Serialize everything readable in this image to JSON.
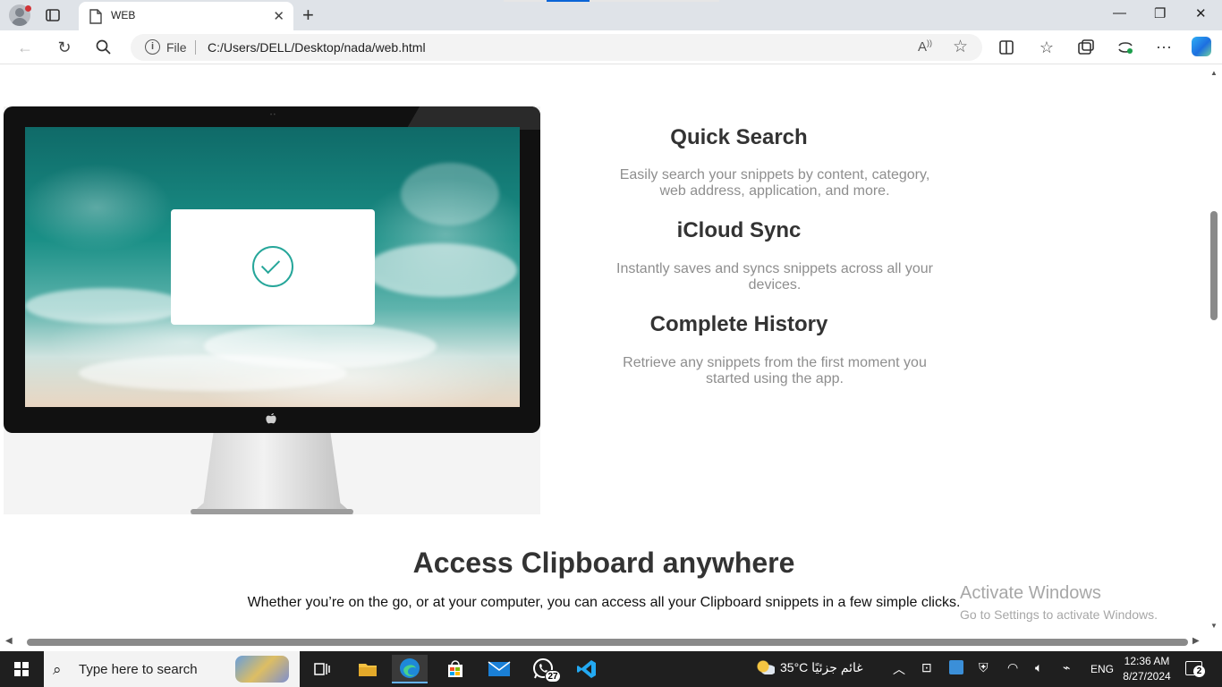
{
  "browser": {
    "tab_title": "WEB",
    "address": {
      "scheme_label": "File",
      "url": "C:/Users/DELL/Desktop/nada/web.html"
    },
    "icons": {
      "back": "back-arrow-icon",
      "refresh": "refresh-icon",
      "search": "search-icon",
      "read_aloud": "read-aloud-icon",
      "favorite": "star-icon",
      "split_screen": "split-screen-icon",
      "favorites": "favorites-icon",
      "collections": "collections-icon",
      "extensions": "extensions-icon",
      "more": "more-icon",
      "copilot": "copilot-icon"
    }
  },
  "page": {
    "features": [
      {
        "title": "Quick Search",
        "description": "Easily search your snippets by content, category, web address, application, and more."
      },
      {
        "title": "iCloud Sync",
        "description": "Instantly saves and syncs snippets across all your devices."
      },
      {
        "title": "Complete History",
        "description": "Retrieve any snippets from the first moment you started using the app."
      }
    ],
    "section": {
      "title": "Access Clipboard anywhere",
      "description": "Whether you’re on the go, or at your computer, you can access all your Clipboard snippets in a few simple clicks."
    },
    "watermark": {
      "line1": "Activate Windows",
      "line2": "Go to Settings to activate Windows."
    },
    "accent_color": "#26a69a"
  },
  "taskbar": {
    "search_placeholder": "Type here to search",
    "whatsapp_badge": "27",
    "weather": "35°C  غائم جزئيًا",
    "language": "ENG",
    "time": "12:36 AM",
    "date": "8/27/2024",
    "notifications": "2"
  }
}
